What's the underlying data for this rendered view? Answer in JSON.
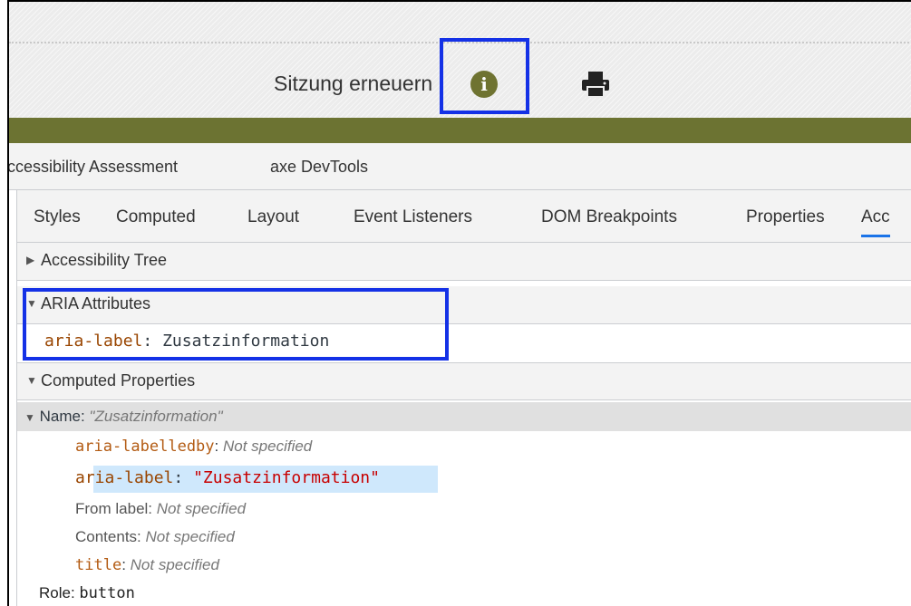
{
  "page": {
    "session_label": "Sitzung erneuern",
    "info_icon": "info-circle-icon",
    "print_icon": "printer-icon",
    "colors": {
      "band": "#6c7332",
      "info_icon": "#6f7331",
      "highlight": "#1431e6"
    }
  },
  "devtools": {
    "top_tabs": [
      "ccessibility Assessment",
      "axe DevTools"
    ],
    "sub_tabs": [
      "Styles",
      "Computed",
      "Layout",
      "Event Listeners",
      "DOM Breakpoints",
      "Properties",
      "Acc"
    ],
    "sections": {
      "tree": "Accessibility Tree",
      "aria": "ARIA Attributes",
      "computed": "Computed Properties"
    },
    "aria_attr": {
      "name": "aria-label",
      "sep": ": ",
      "value": "Zusatzinformation"
    },
    "computed": {
      "name_label": "Name: ",
      "name_value": "\"Zusatzinformation\"",
      "labelledby_name": "aria-labelledby",
      "labelledby_value": "Not specified",
      "label_name": "aria-label",
      "label_value": "\"Zusatzinformation\"",
      "from_label_name": "From label: ",
      "from_label_value": "Not specified",
      "contents_name": "Contents: ",
      "contents_value": "Not specified",
      "title_name": "title",
      "title_value": "Not specified",
      "role_label": "Role: ",
      "role_value": "button"
    }
  }
}
